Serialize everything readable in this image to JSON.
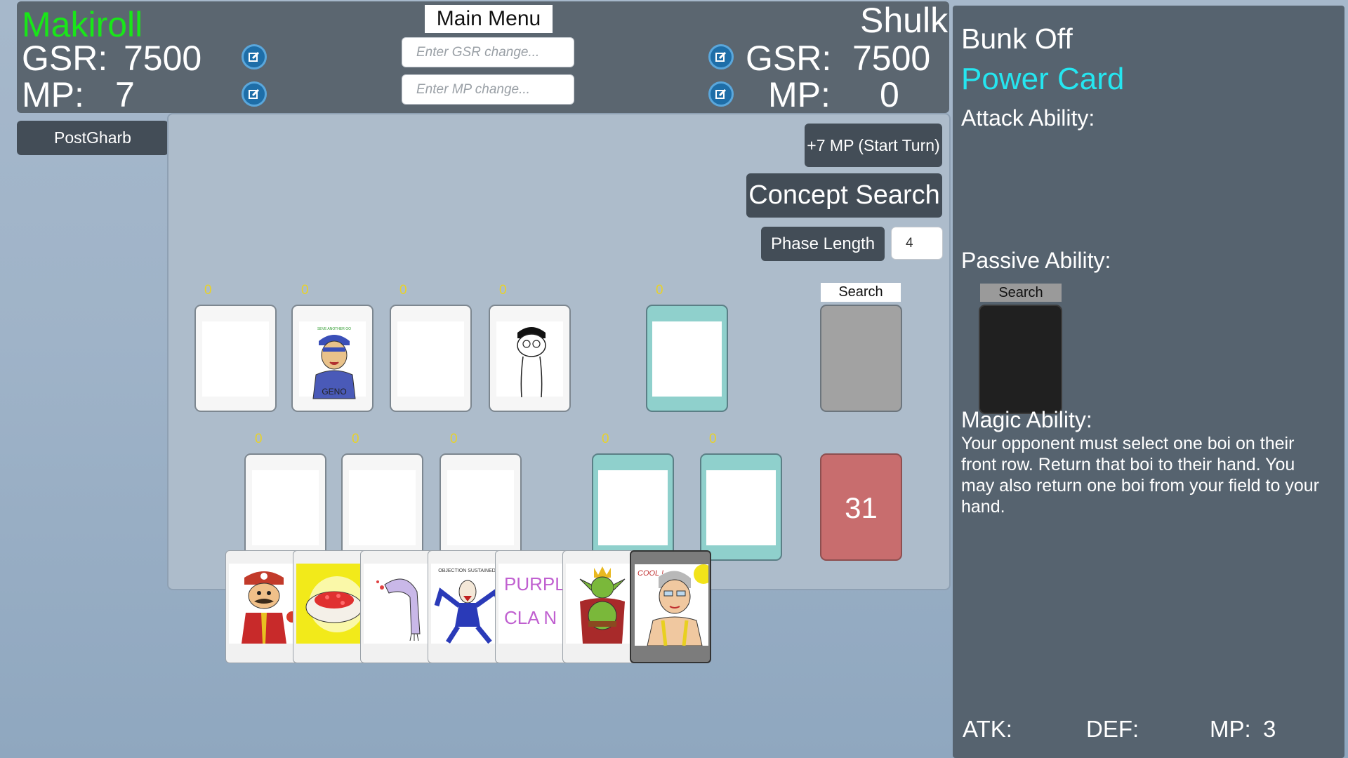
{
  "top": {
    "player_left": {
      "name": "Makiroll",
      "gsr_label": "GSR:",
      "gsr": "7500",
      "mp_label": "MP:",
      "mp": "7"
    },
    "player_right": {
      "name": "Shulk",
      "gsr_label": "GSR:",
      "gsr": "7500",
      "mp_label": "MP:",
      "mp": "0"
    },
    "main_menu_label": "Main Menu",
    "gsr_input_placeholder": "Enter GSR change...",
    "mp_input_placeholder": "Enter MP change..."
  },
  "postgharb_label": "PostGharb",
  "controls": {
    "start_turn_label": "+7 MP (Start Turn)",
    "concept_search_label": "Concept Search",
    "phase_length_label": "Phase Length",
    "phase_length_value": "4"
  },
  "board": {
    "top_row_counters": [
      "0",
      "0",
      "0",
      "0",
      "0"
    ],
    "bottom_row_counters": [
      "0",
      "0",
      "0",
      "0",
      "0"
    ],
    "search_label": "Search",
    "deck_count": "31"
  },
  "hand": [
    "mario-card",
    "strawberry-cake-card",
    "arm-card",
    "objection-card",
    "purple-clan-card",
    "goblin-king-card",
    "cool-old-man-card"
  ],
  "card_text": {
    "geno": "GENO",
    "objection": "OBJECTION SUSTAINED!",
    "purple": "PURPL",
    "clan": "CLA N",
    "cool": "COOL !"
  },
  "panel": {
    "card_name": "Bunk Off",
    "card_type": "Power Card",
    "attack_label": "Attack Ability:",
    "passive_label": "Passive Ability:",
    "search_label": "Search",
    "magic_label": "Magic Ability:",
    "magic_text": "Your opponent must select one boi on their front row. Return that boi to their hand. You may also return one boi from your field to your hand.",
    "atk_label": "ATK:",
    "def_label": "DEF:",
    "mp_label": "MP:",
    "mp_value": "3"
  },
  "colors": {
    "player_left_name": "#19e619",
    "card_type": "#25e6f0",
    "deck": "#c86d6e",
    "counter": "#e8d22a"
  }
}
